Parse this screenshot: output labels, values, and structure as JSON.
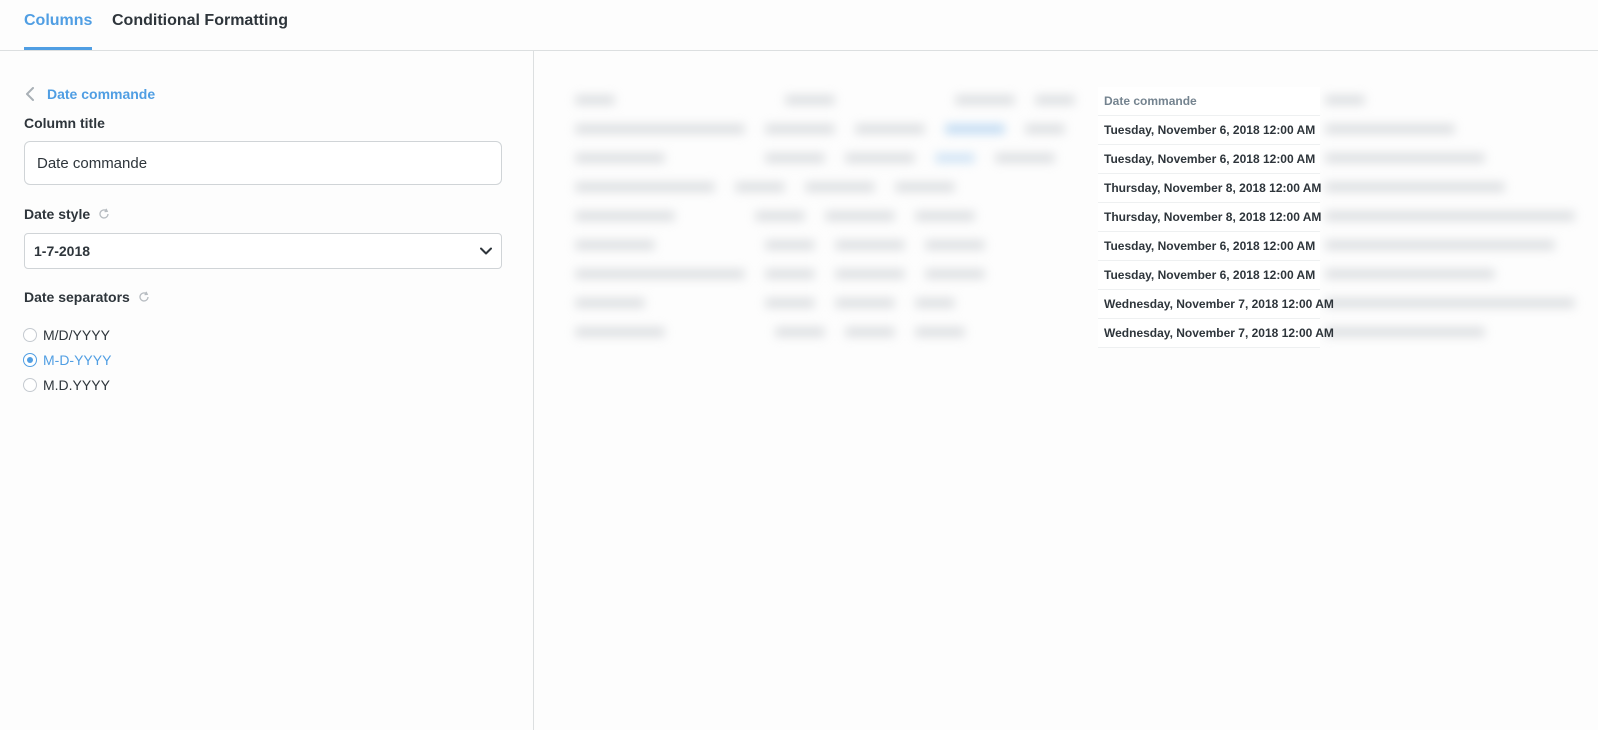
{
  "tabs": [
    {
      "label": "Columns",
      "active": true
    },
    {
      "label": "Conditional Formatting",
      "active": false
    }
  ],
  "back": {
    "label": "Date commande"
  },
  "column_title": {
    "label": "Column title",
    "value": "Date commande"
  },
  "date_style": {
    "label": "Date style",
    "selected": "1-7-2018"
  },
  "date_separators": {
    "label": "Date separators",
    "options": [
      {
        "label": "M/D/YYYY",
        "checked": false
      },
      {
        "label": "M-D-YYYY",
        "checked": true
      },
      {
        "label": "M.D.YYYY",
        "checked": false
      }
    ]
  },
  "preview": {
    "column_header": "Date commande",
    "rows": [
      "Tuesday, November 6, 2018 12:00 AM",
      "Tuesday, November 6, 2018 12:00 AM",
      "Thursday, November 8, 2018 12:00 AM",
      "Thursday, November 8, 2018 12:00 AM",
      "Tuesday, November 6, 2018 12:00 AM",
      "Tuesday, November 6, 2018 12:00 AM",
      "Wednesday, November 7, 2018 12:00 AM",
      "Wednesday, November 7, 2018 12:00 AM"
    ]
  },
  "colors": {
    "accent": "#509ee3",
    "text": "#2e353b",
    "border": "#dcdfe0"
  }
}
